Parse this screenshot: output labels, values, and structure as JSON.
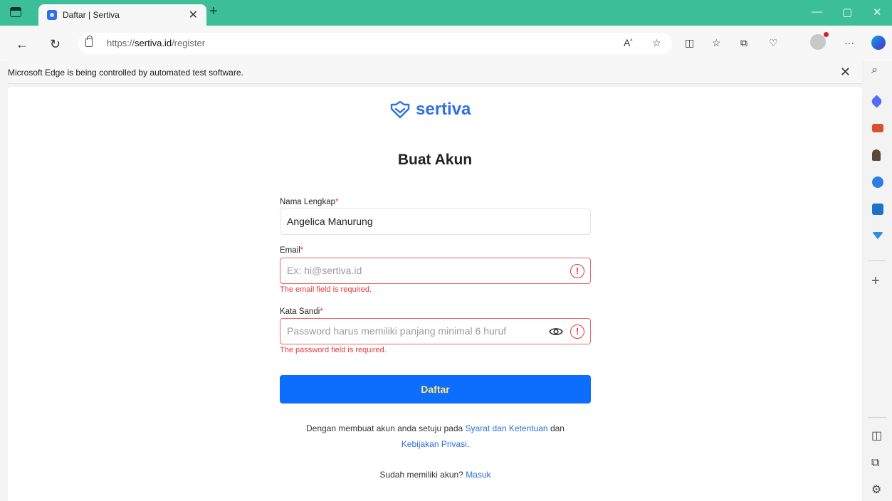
{
  "browser": {
    "tab_title": "Daftar | Sertiva",
    "url_prefix": "https://",
    "url_domain": "sertiva.id",
    "url_path": "/register",
    "infobar_text": "Microsoft Edge is being controlled by automated test software.",
    "toolbar_icons": [
      "read-aloud-icon",
      "favorite-star-icon",
      "split-screen-icon",
      "favorites-icon",
      "collections-icon",
      "browser-essentials-icon",
      "profile-icon",
      "more-icon",
      "copilot-icon"
    ],
    "sidebar_icons": [
      "search-icon",
      "shopping-tag-icon",
      "tools-icon",
      "games-icon",
      "m365-icon",
      "outlook-icon",
      "drop-icon",
      "add-icon",
      "hide-sidebar-icon",
      "open-external-icon",
      "settings-icon"
    ]
  },
  "brand": {
    "name": "sertiva",
    "color": "#2f6fe8"
  },
  "form": {
    "title": "Buat Akun",
    "name_label": "Nama Lengkap",
    "name_value": "Angelica Manurung",
    "email_label": "Email",
    "email_placeholder": "Ex: hi@sertiva.id",
    "email_error": "The email field is required.",
    "password_label": "Kata Sandi",
    "password_placeholder": "Password harus memiliki panjang minimal 6 huruf",
    "password_error": "The password field is required.",
    "required_mark": "*",
    "submit_label": "Daftar",
    "terms_prefix": "Dengan membuat akun anda setuju pada ",
    "terms_link": "Syarat dan Ketentuan",
    "terms_and": " dan",
    "privacy_link": "Kebijakan Privasi",
    "terms_suffix": ".",
    "login_prompt": "Sudah memiliki akun? ",
    "login_link": "Masuk"
  },
  "colors": {
    "titlebar": "#3cbf98",
    "primary_button": "#0d6efd",
    "error": "#e23a3a",
    "link": "#2b6fd6"
  }
}
